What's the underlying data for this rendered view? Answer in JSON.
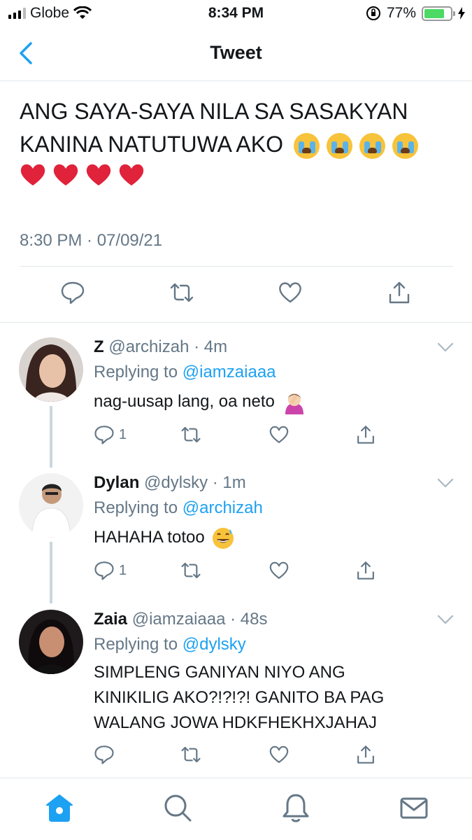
{
  "status_bar": {
    "carrier": "Globe",
    "time": "8:34 PM",
    "battery": "77%",
    "battery_level": 0.77,
    "icons": [
      "signal-icon",
      "wifi-icon",
      "orientation-lock-icon",
      "battery-icon",
      "charging-icon"
    ]
  },
  "header": {
    "title": "Tweet",
    "back_icon": "back-chevron-icon"
  },
  "main_tweet": {
    "text_line1": "ANG SAYA-SAYA NILA SA SASAKYAN",
    "text_line2": "KANINA NATUTUWA AKO",
    "emojis_line2": [
      "loudly-crying-face",
      "loudly-crying-face",
      "loudly-crying-face",
      "loudly-crying-face"
    ],
    "emojis_line3": [
      "red-heart",
      "red-heart",
      "red-heart",
      "red-heart"
    ],
    "timestamp": "8:30 PM · 07/09/21",
    "actions": [
      "reply-icon",
      "retweet-icon",
      "like-icon",
      "share-icon"
    ]
  },
  "replies": [
    {
      "name": "Z",
      "handle": "@archizah",
      "age": "· 4m",
      "replying_label": "Replying to",
      "replying_to": "@iamzaiaaa",
      "text": "nag-uusap lang, oa neto",
      "emoji": "woman-facepalming",
      "reply_count": "1"
    },
    {
      "name": "Dylan",
      "handle": "@dylsky",
      "age": "· 1m",
      "replying_label": "Replying to",
      "replying_to": "@archizah",
      "text": "HAHAHA totoo",
      "emoji": "grinning-face-with-sweat",
      "reply_count": "1"
    },
    {
      "name": "Zaia",
      "handle": "@iamzaiaaa",
      "age": "· 48s",
      "replying_label": "Replying to",
      "replying_to": "@dylsky",
      "text_line1": "SIMPLENG GANIYAN NIYO ANG",
      "text_line2": "KINIKILIG AKO?!?!?! GANITO BA PAG",
      "text_line3": "WALANG JOWA HDKFHEKHXJAHAJ",
      "reply_count": ""
    }
  ],
  "tab_bar": {
    "tabs": [
      "home-icon",
      "search-icon",
      "notifications-icon",
      "messages-icon"
    ],
    "active": "home-icon"
  },
  "colors": {
    "accent": "#1da1f2",
    "secondary_text": "#657786",
    "divider": "#e1e8ed",
    "battery_green": "#4cd964"
  }
}
